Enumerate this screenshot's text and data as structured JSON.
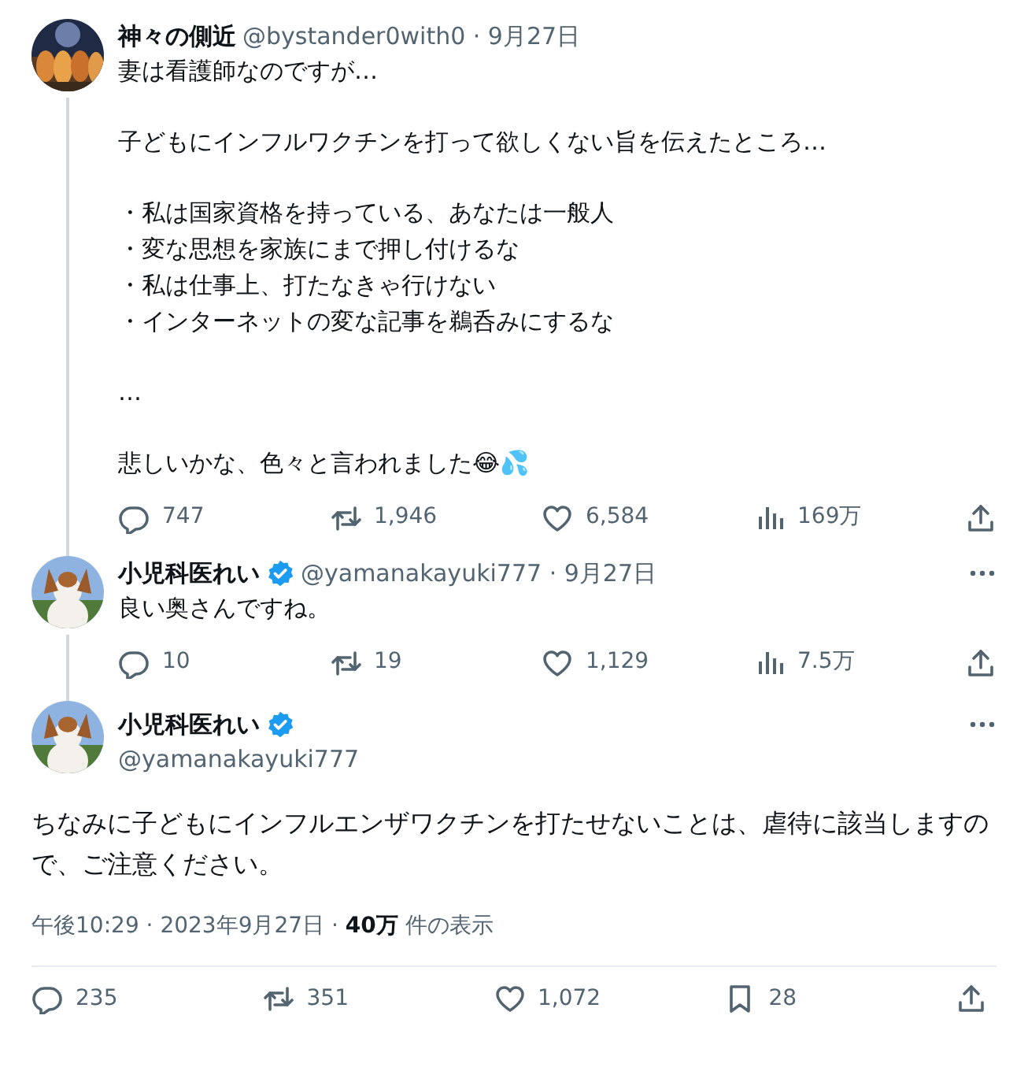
{
  "thread": [
    {
      "name": "神々の側近",
      "verified": false,
      "byline": "@bystander0with0 · 9月27日",
      "more": false,
      "paragraphs": [
        [
          "妻は看護師なのですが…"
        ],
        [
          "子どもにインフルワクチンを打って欲しくない旨を伝えたところ…"
        ],
        [
          "・私は国家資格を持っている、あなたは一般人",
          "・変な思想を家族にまで押し付けるな",
          "・私は仕事上、打たなきゃ行けない",
          "・インターネットの変な記事を鵜呑みにするな"
        ],
        [
          "…"
        ],
        [
          "悲しいかな、色々と言われました😂💦"
        ]
      ],
      "stats": [
        {
          "kind": "reply",
          "count": "747"
        },
        {
          "kind": "retweet",
          "count": "1,946"
        },
        {
          "kind": "like",
          "count": "6,584"
        },
        {
          "kind": "views",
          "count": "169万"
        },
        {
          "kind": "share"
        }
      ]
    },
    {
      "name": "小児科医れい",
      "verified": true,
      "byline": "@yamanakayuki777 · 9月27日",
      "more": true,
      "paragraphs": [
        [
          "良い奥さんですね。"
        ]
      ],
      "stats": [
        {
          "kind": "reply",
          "count": "10"
        },
        {
          "kind": "retweet",
          "count": "19"
        },
        {
          "kind": "like",
          "count": "1,129"
        },
        {
          "kind": "views",
          "count": "7.5万"
        },
        {
          "kind": "share"
        }
      ]
    }
  ],
  "main": {
    "name": "小児科医れい",
    "verified": true,
    "handle": "@yamanakayuki777",
    "more": true,
    "body": "ちなみに子どもにインフルエンザワクチンを打たせないことは、虐待に該当しますので、ご注意ください。",
    "meta": "午後10:29 · 2023年9月27日 · **40万** 件の表示",
    "stats": [
      {
        "kind": "reply",
        "count": "235"
      },
      {
        "kind": "retweet",
        "count": "351"
      },
      {
        "kind": "like",
        "count": "1,072"
      },
      {
        "kind": "bookmark",
        "count": "28"
      },
      {
        "kind": "share"
      }
    ]
  }
}
